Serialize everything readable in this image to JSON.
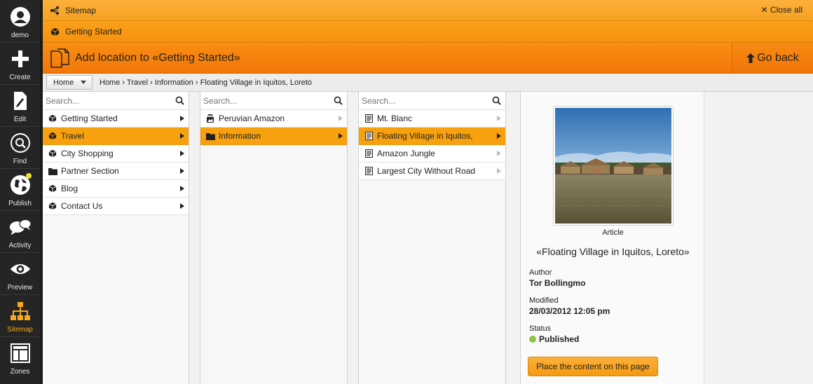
{
  "sidebar": {
    "items": [
      {
        "label": "demo",
        "icon": "user-avatar-icon"
      },
      {
        "label": "Create",
        "icon": "plus-icon"
      },
      {
        "label": "Edit",
        "icon": "pencil-document-icon"
      },
      {
        "label": "Find",
        "icon": "search-icon"
      },
      {
        "label": "Publish",
        "icon": "globe-icon"
      },
      {
        "label": "Activity",
        "icon": "chat-bubbles-icon"
      },
      {
        "label": "Preview",
        "icon": "eye-icon"
      },
      {
        "label": "Sitemap",
        "icon": "sitemap-icon"
      },
      {
        "label": "Zones",
        "icon": "layout-icon"
      }
    ],
    "active": "Sitemap"
  },
  "topbar": {
    "sitemap_label": "Sitemap",
    "close_all_label": "Close all",
    "context_label": "Getting Started",
    "action_title": "Add location to «Getting Started»",
    "go_back_label": "Go back"
  },
  "breadcrumb": {
    "home_label": "Home",
    "path": "Home › Travel › Information › Floating Village in Iquitos, Loreto"
  },
  "columns": [
    {
      "search_placeholder": "Search...",
      "items": [
        {
          "label": "Getting Started",
          "icon": "cube-icon",
          "selected": false
        },
        {
          "label": "Travel",
          "icon": "cube-icon",
          "selected": true
        },
        {
          "label": "City Shopping",
          "icon": "cube-icon",
          "selected": false
        },
        {
          "label": "Partner Section",
          "icon": "folder-icon",
          "selected": false
        },
        {
          "label": "Blog",
          "icon": "cube-icon",
          "selected": false
        },
        {
          "label": "Contact Us",
          "icon": "cube-icon",
          "selected": false
        }
      ]
    },
    {
      "search_placeholder": "Search...",
      "items": [
        {
          "label": "Peruvian Amazon",
          "icon": "gallery-icon",
          "selected": false
        },
        {
          "label": "Information",
          "icon": "folder-icon",
          "selected": true
        }
      ]
    },
    {
      "search_placeholder": "Search...",
      "items": [
        {
          "label": "Mt. Blanc",
          "icon": "article-icon",
          "selected": false
        },
        {
          "label": "Floating Village in Iquitos,",
          "icon": "article-icon",
          "selected": true
        },
        {
          "label": "Amazon Jungle",
          "icon": "article-icon",
          "selected": false
        },
        {
          "label": "Largest City Without Road",
          "icon": "article-icon",
          "selected": false
        }
      ]
    }
  ],
  "detail": {
    "content_type": "Article",
    "title": "«Floating Village in Iquitos, Loreto»",
    "author_label": "Author",
    "author": "Tor Bollingmo",
    "modified_label": "Modified",
    "modified": "28/03/2012 12:05 pm",
    "status_label": "Status",
    "status": "Published",
    "status_color": "#8cc63f",
    "place_button_label": "Place the content on this page"
  },
  "colors": {
    "accent": "#f7a10f",
    "sidebar_bg": "#252525",
    "sidebar_active": "#f7a81b"
  }
}
